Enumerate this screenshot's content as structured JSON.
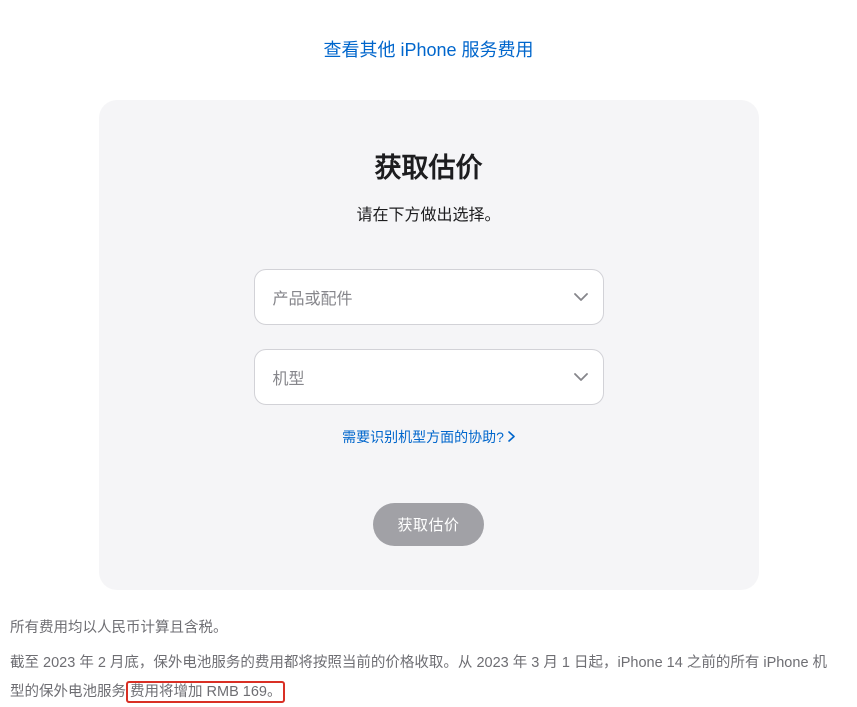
{
  "topLink": {
    "label": "查看其他 iPhone 服务费用"
  },
  "card": {
    "title": "获取估价",
    "subtitle": "请在下方做出选择。",
    "select1": {
      "placeholder": "产品或配件"
    },
    "select2": {
      "placeholder": "机型"
    },
    "helpLink": {
      "label": "需要识别机型方面的协助?"
    },
    "submit": {
      "label": "获取估价"
    }
  },
  "footer": {
    "line1": "所有费用均以人民币计算且含税。",
    "line2_part1": "截至 2023 年 2 月底，保外电池服务的费用都将按照当前的价格收取。从 2023 年 3 月 1 日起，iPhone 14 之前的所有 iPhone 机型的保外电池服务",
    "line2_highlight": "费用将增加 RMB 169。"
  }
}
